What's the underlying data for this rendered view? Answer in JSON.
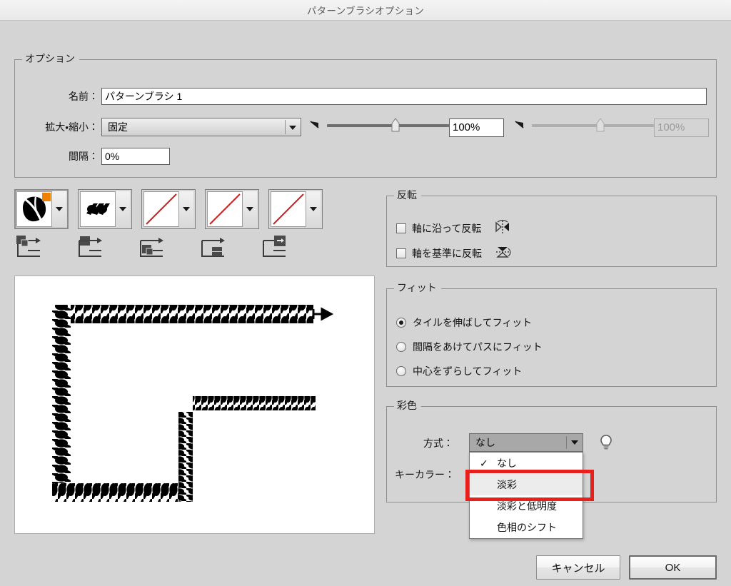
{
  "window": {
    "title": "パターンブラシオプション"
  },
  "options_group": {
    "legend": "オプション",
    "name_label": "名前：",
    "name_value": "パターンブラシ 1",
    "scale_label": "拡大・縮小：",
    "scale_value": "固定",
    "scale_slider_value": "100%",
    "pressure_slider_value": "100%",
    "spacing_label": "間隔：",
    "spacing_value": "0%"
  },
  "tiles": {
    "items": [
      {
        "name": "side-tile",
        "state": "filled",
        "selected": true,
        "has_badge": true
      },
      {
        "name": "outer-corner-tile",
        "state": "filled",
        "selected": false,
        "has_badge": false
      },
      {
        "name": "inner-corner-tile",
        "state": "empty",
        "selected": false,
        "has_badge": false
      },
      {
        "name": "start-tile",
        "state": "empty",
        "selected": false,
        "has_badge": false
      },
      {
        "name": "end-tile",
        "state": "empty",
        "selected": false,
        "has_badge": false
      }
    ],
    "corner_icons": [
      "side-tile-position-icon",
      "outer-corner-tile-position-icon",
      "inner-corner-tile-position-icon",
      "start-tile-position-icon",
      "end-tile-position-icon"
    ]
  },
  "flip_group": {
    "legend": "反転",
    "items": [
      {
        "label": "軸に沿って反転",
        "checked": false,
        "icon": "flip-along-axis-icon"
      },
      {
        "label": "軸を基準に反転",
        "checked": false,
        "icon": "flip-across-axis-icon"
      }
    ]
  },
  "fit_group": {
    "legend": "フィット",
    "items": [
      {
        "label": "タイルを伸ばしてフィット",
        "checked": true
      },
      {
        "label": "間隔をあけてパスにフィット",
        "checked": false
      },
      {
        "label": "中心をずらしてフィット",
        "checked": false
      }
    ]
  },
  "colorization_group": {
    "legend": "彩色",
    "method_label": "方式：",
    "method_value": "なし",
    "key_color_label": "キーカラー：",
    "tip_icon": "lightbulb-icon",
    "dropdown_options": [
      {
        "label": "なし",
        "checked": true,
        "highlighted": false
      },
      {
        "label": "淡彩",
        "checked": false,
        "highlighted": true
      },
      {
        "label": "淡彩と低明度",
        "checked": false,
        "highlighted": false
      },
      {
        "label": "色相のシフト",
        "checked": false,
        "highlighted": false
      }
    ]
  },
  "footer": {
    "cancel_label": "キャンセル",
    "ok_label": "OK"
  },
  "colors": {
    "dialog_bg": "#d4d4d4",
    "titlebar_bg": "#f1f1f1",
    "annotation_red": "#e8201c",
    "badge_orange": "#f08000",
    "tile_empty_slash": "#cc2222"
  }
}
